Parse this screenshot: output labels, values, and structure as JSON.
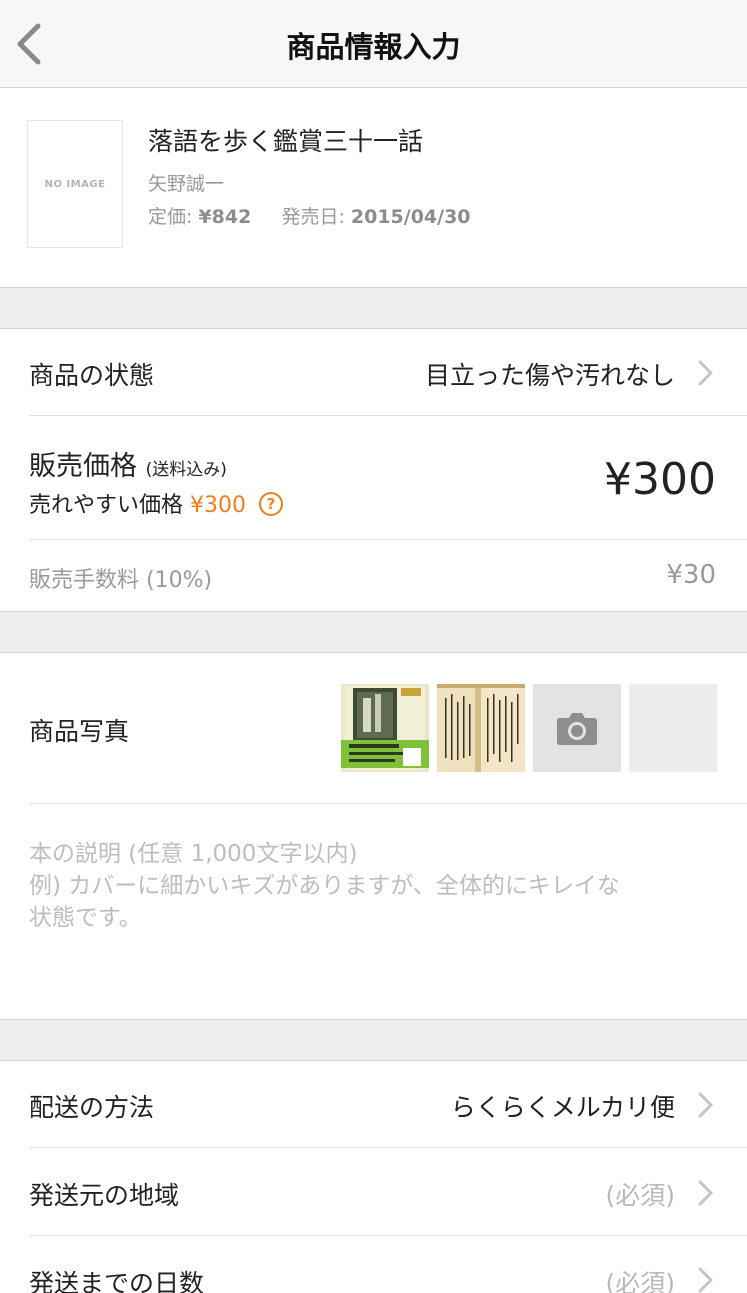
{
  "header": {
    "title": "商品情報入力"
  },
  "product": {
    "no_image_label": "NO IMAGE",
    "title": "落語を歩く鑑賞三十一話",
    "author": "矢野誠一",
    "list_price_label": "定価:",
    "list_price": "¥842",
    "release_label": "発売日:",
    "release_date": "2015/04/30"
  },
  "condition": {
    "label": "商品の状態",
    "value": "目立った傷や汚れなし"
  },
  "price": {
    "label": "販売価格",
    "label_note": "(送料込み)",
    "value": "¥300",
    "easy_label": "売れやすい価格",
    "easy_value": "¥300",
    "help": "?"
  },
  "fee": {
    "label": "販売手数料 (10%)",
    "value": "¥30"
  },
  "photos": {
    "label": "商品写真",
    "thumbnails": [
      "cover-photo",
      "page-photo",
      "camera-icon",
      "empty-slot"
    ]
  },
  "description": {
    "placeholder": "本の説明 (任意 1,000文字以内)\n例) カバーに細かいキズがありますが、全体的にキレイな\n状態です。"
  },
  "shipping_method": {
    "label": "配送の方法",
    "value": "らくらくメルカリ便"
  },
  "ship_from": {
    "label": "発送元の地域",
    "value": "(必須)"
  },
  "ship_days": {
    "label": "発送までの日数",
    "value": "(必須)"
  },
  "colors": {
    "accent": "#f07f1b",
    "placeholder": "#bdbdbd",
    "gap": "#efefef"
  }
}
